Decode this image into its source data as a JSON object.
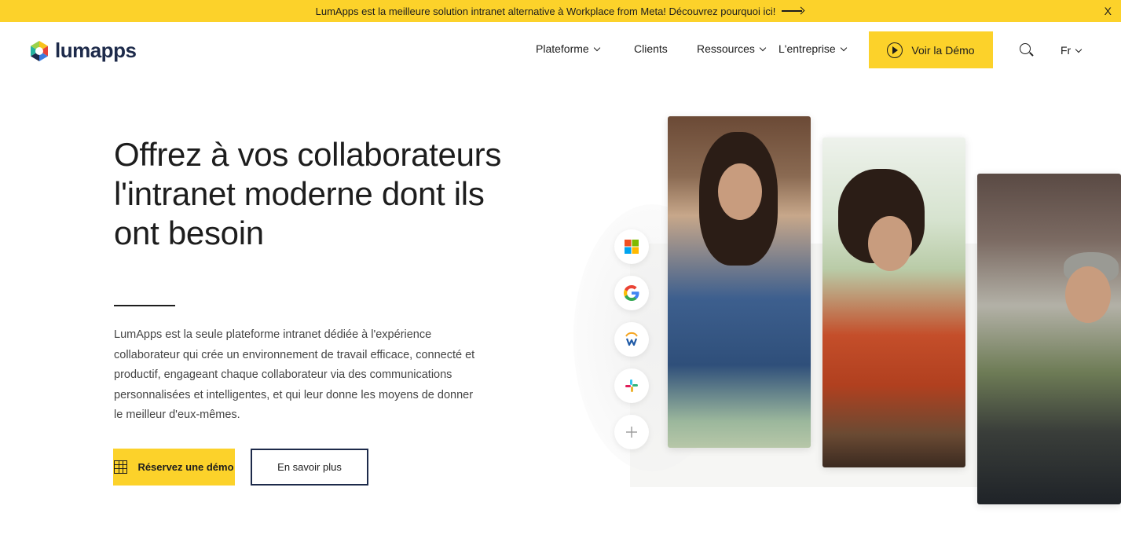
{
  "banner": {
    "text": "LumApps est la meilleure solution intranet alternative à Workplace from Meta! Découvrez pourquoi ici!",
    "close": "X"
  },
  "header": {
    "logo_text": "lumapps",
    "nav": [
      {
        "label": "Plateforme",
        "dropdown": true
      },
      {
        "label": "Clients",
        "dropdown": false
      },
      {
        "label": "Ressources",
        "dropdown": true
      },
      {
        "label": "L'entreprise",
        "dropdown": true
      }
    ],
    "demo_button": "Voir la Démo",
    "language": "Fr"
  },
  "hero": {
    "title": "Offrez à vos collaborateurs l'intranet moderne dont ils ont besoin",
    "description": "LumApps est la seule plateforme intranet dédiée à l'expérience collaborateur qui crée un environnement de travail efficace, connecté et productif, engageant chaque collaborateur via des communications personnalisées et intelligentes, et qui leur donne les moyens de donner le meilleur d'eux-mêmes.",
    "primary_button": "Réservez une démo",
    "secondary_button": "En savoir plus"
  },
  "integrations": [
    "microsoft-icon",
    "google-icon",
    "workday-icon",
    "slack-icon",
    "plus-icon"
  ],
  "colors": {
    "accent": "#fcd22a",
    "brand_dark": "#1d2a4a",
    "text": "#1d1d1d"
  }
}
